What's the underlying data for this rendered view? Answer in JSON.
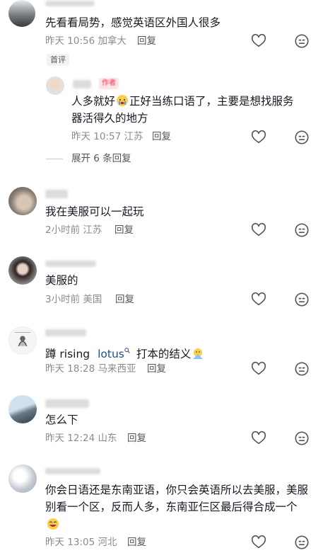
{
  "comments": [
    {
      "text": "先看看局势，感觉英语区外国人很多",
      "time": "昨天 10:56",
      "location": "加拿大",
      "reply_label": "回复",
      "tag": "首评",
      "replies": [
        {
          "author_badge": "作者",
          "text_a": "人多就好",
          "text_b": "正好当练口语了，主要是想找服务",
          "text_c": "器活得久的地方",
          "time": "昨天 10:57",
          "location": "江苏",
          "reply_label": "回复"
        }
      ],
      "expand_label": "展开 6 条回复"
    },
    {
      "text": "我在美服可以一起玩",
      "time": "2小时前",
      "location": "江苏",
      "reply_label": "回复"
    },
    {
      "text": "美服的",
      "time": "3小时前",
      "location": "美国",
      "reply_label": "回复"
    },
    {
      "text_a": "蹲 rising",
      "text_b": "lotus",
      "text_c": "打本的结义",
      "time": "昨天 18:28",
      "location": "马来西亚",
      "reply_label": "回复"
    },
    {
      "text": "怎么下",
      "time": "昨天 12:24",
      "location": "山东",
      "reply_label": "回复"
    },
    {
      "line1": "你会日语还是东南亚语，你只会英语所以去美服，美服",
      "line2": "别看一个区，反而人多，东南亚仨区最后得合成一个",
      "time": "昨天 13:05",
      "location": "河北",
      "reply_label": "回复"
    }
  ],
  "icons": {
    "like": "heart-outline-icon",
    "dislike": "neutral-face-icon",
    "search_marker": "search-superscript-icon"
  },
  "colors": {
    "text": "#161823",
    "meta": "#8a8b91",
    "link": "#1a4f8b",
    "author_badge_bg": "#fde3e6",
    "author_badge_fg": "#fe2c55",
    "tag_bg": "#f2f2f4"
  }
}
